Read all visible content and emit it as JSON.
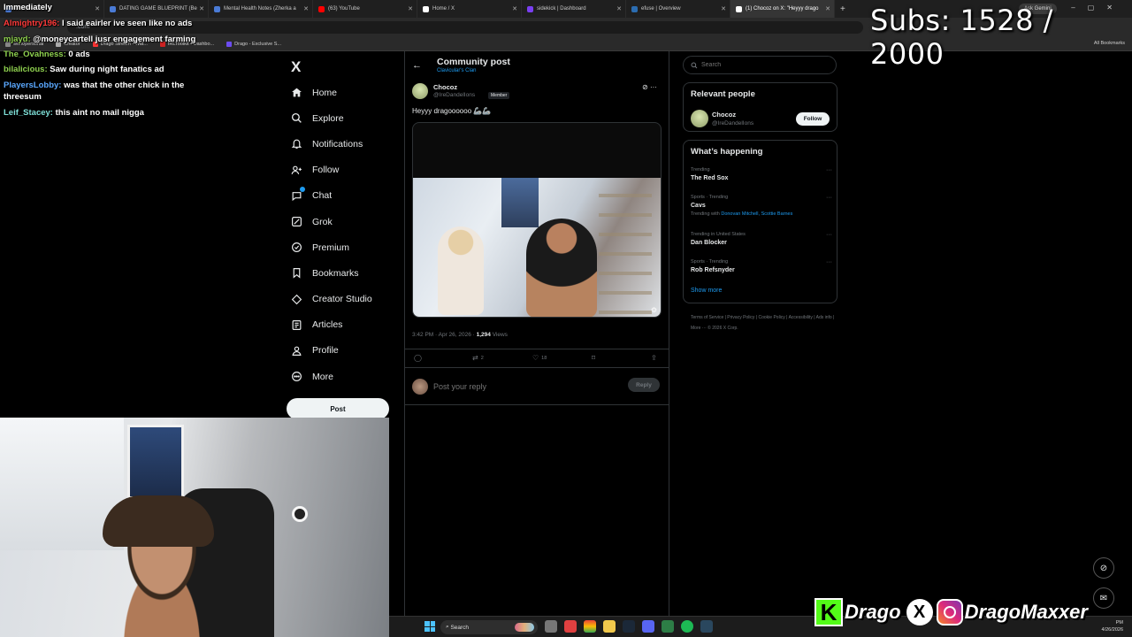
{
  "browser": {
    "tabs": [
      {
        "label": "Dashboard",
        "color": "#4a7bd6"
      },
      {
        "label": "DATING GAME BLUEPRINT (Be",
        "color": "#4a7bd6"
      },
      {
        "label": "Mental Health Notes (Zherka a",
        "color": "#4a7bd6"
      },
      {
        "label": "(63) YouTube",
        "color": "#ff0000"
      },
      {
        "label": "Home / X",
        "color": "#ffffff"
      },
      {
        "label": "sidekick | Dashboard",
        "color": "#7a3ff2"
      },
      {
        "label": "efuse | Overview",
        "color": "#2b6cb0"
      },
      {
        "label": "(1) Chocoz on X: \"Heyyy drago",
        "color": "#ffffff"
      }
    ],
    "new_tab": "+",
    "gemini": "Ask Gemini",
    "url": ".com",
    "bookmarks": [
      {
        "label": "work/personal",
        "color": "#888888"
      },
      {
        "label": "Creator",
        "color": "#aaaaaa"
      },
      {
        "label": "Drago Stream - Wat...",
        "color": "#ff3333"
      },
      {
        "label": "IRLToolkit • Dashbo...",
        "color": "#cc2222"
      },
      {
        "label": "Drago - Exclusive S...",
        "color": "#6c4cf0"
      }
    ],
    "all_bookmarks": "All Bookmarks"
  },
  "chat": [
    {
      "user": "Immediately",
      "msg": "",
      "class": "plain"
    },
    {
      "user": "Almightry196:",
      "msg": "I said eairler ive seen like no ads",
      "class": "red"
    },
    {
      "user": "mjayd:",
      "msg": "@moneycartell jusr engagement farming",
      "class": ""
    },
    {
      "user": "The_Ovahness:",
      "msg": "0 ads",
      "class": ""
    },
    {
      "user": "bilalicious:",
      "msg": "Saw during night fanatics ad",
      "class": ""
    },
    {
      "user": "PlayersLobby:",
      "msg": "was that the other chick in the",
      "class": "blue"
    },
    {
      "user": "",
      "msg": "threesum",
      "class": ""
    },
    {
      "user": "Leif_Stacey:",
      "msg": "this aint no mail nigga",
      "class": "cyan"
    }
  ],
  "subs": {
    "text": "Subs: 1528 / 2000"
  },
  "x": {
    "logo": "X",
    "nav": [
      {
        "label": "Home",
        "icon": "home-icon"
      },
      {
        "label": "Explore",
        "icon": "search-icon"
      },
      {
        "label": "Notifications",
        "icon": "bell-icon"
      },
      {
        "label": "Follow",
        "icon": "follow-icon"
      },
      {
        "label": "Chat",
        "icon": "chat-icon"
      },
      {
        "label": "Grok",
        "icon": "grok-icon"
      },
      {
        "label": "Premium",
        "icon": "premium-icon"
      },
      {
        "label": "Bookmarks",
        "icon": "bookmark-icon"
      },
      {
        "label": "Creator Studio",
        "icon": "creator-studio-icon"
      },
      {
        "label": "Articles",
        "icon": "articles-icon"
      },
      {
        "label": "Profile",
        "icon": "profile-icon"
      },
      {
        "label": "More",
        "icon": "more-icon"
      }
    ],
    "post_button": "Post",
    "header": {
      "title": "Community post",
      "subtitle": "Clavicular's Clan"
    },
    "post": {
      "author": "Chocoz",
      "handle": "@IreDandelIons",
      "badge": "Member",
      "text": "Heyyy dragoooooo 🦾🦾",
      "time": "3:42 PM · Apr 26, 2026 · ",
      "views_count": "1,294",
      "views_label": " Views",
      "retweets": "2",
      "likes": "18"
    },
    "reply": {
      "placeholder": "Post your reply",
      "button": "Reply"
    },
    "search": {
      "placeholder": "Search"
    },
    "relevant": {
      "title": "Relevant people",
      "name": "Chocoz",
      "handle": "@IreDandelIons",
      "follow": "Follow"
    },
    "happening": {
      "title": "What’s happening",
      "trends": [
        {
          "category": "Trending",
          "name": "The Red Sox",
          "with_label": "",
          "with_names": ""
        },
        {
          "category": "Sports · Trending",
          "name": "Cavs",
          "with_label": "Trending with ",
          "with_names": "Donovan Mitchell, Scottie Barnes"
        },
        {
          "category": "Trending in United States",
          "name": "Dan Blocker",
          "with_label": "",
          "with_names": ""
        },
        {
          "category": "Sports · Trending",
          "name": "Rob Refsnyder",
          "with_label": "",
          "with_names": ""
        }
      ],
      "show_more": "Show more"
    },
    "footer": "Terms of Service  |  Privacy Policy  |  Cookie Policy  |  Accessibility  |  Ads info  |  More ···  © 2026 X Corp."
  },
  "socials": {
    "kick": "Drago",
    "instagram": "DragoMaxxer"
  },
  "taskbar": {
    "search": "Search",
    "time": "PM",
    "date": "4/26/2026"
  }
}
